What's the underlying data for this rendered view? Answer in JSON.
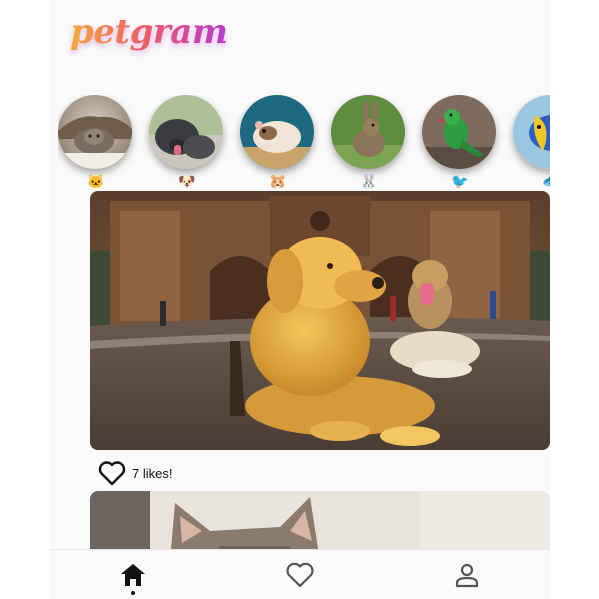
{
  "app": {
    "title": "petgram"
  },
  "stories": [
    {
      "name": "cat",
      "emoji": "🐱",
      "colors": [
        "#e8e2d8",
        "#6b5a4a"
      ]
    },
    {
      "name": "dog",
      "emoji": "🐶",
      "colors": [
        "#bcd0a8",
        "#3b3e44"
      ]
    },
    {
      "name": "hamster",
      "emoji": "🐹",
      "colors": [
        "#1f6f83",
        "#e8d7c3"
      ]
    },
    {
      "name": "rabbit",
      "emoji": "🐰",
      "colors": [
        "#6d9a4b",
        "#8b735a"
      ]
    },
    {
      "name": "bird",
      "emoji": "🐦",
      "colors": [
        "#8a7868",
        "#3aa14a"
      ]
    },
    {
      "name": "fish",
      "emoji": "🐟",
      "colors": [
        "#8ab9d6",
        "#e8c22a"
      ]
    }
  ],
  "posts": [
    {
      "likes_text": "7 likes!",
      "liked": false
    },
    {
      "likes_text": ""
    }
  ],
  "nav": [
    {
      "name": "home",
      "active": true
    },
    {
      "name": "favorites",
      "active": false
    },
    {
      "name": "profile",
      "active": false
    }
  ]
}
